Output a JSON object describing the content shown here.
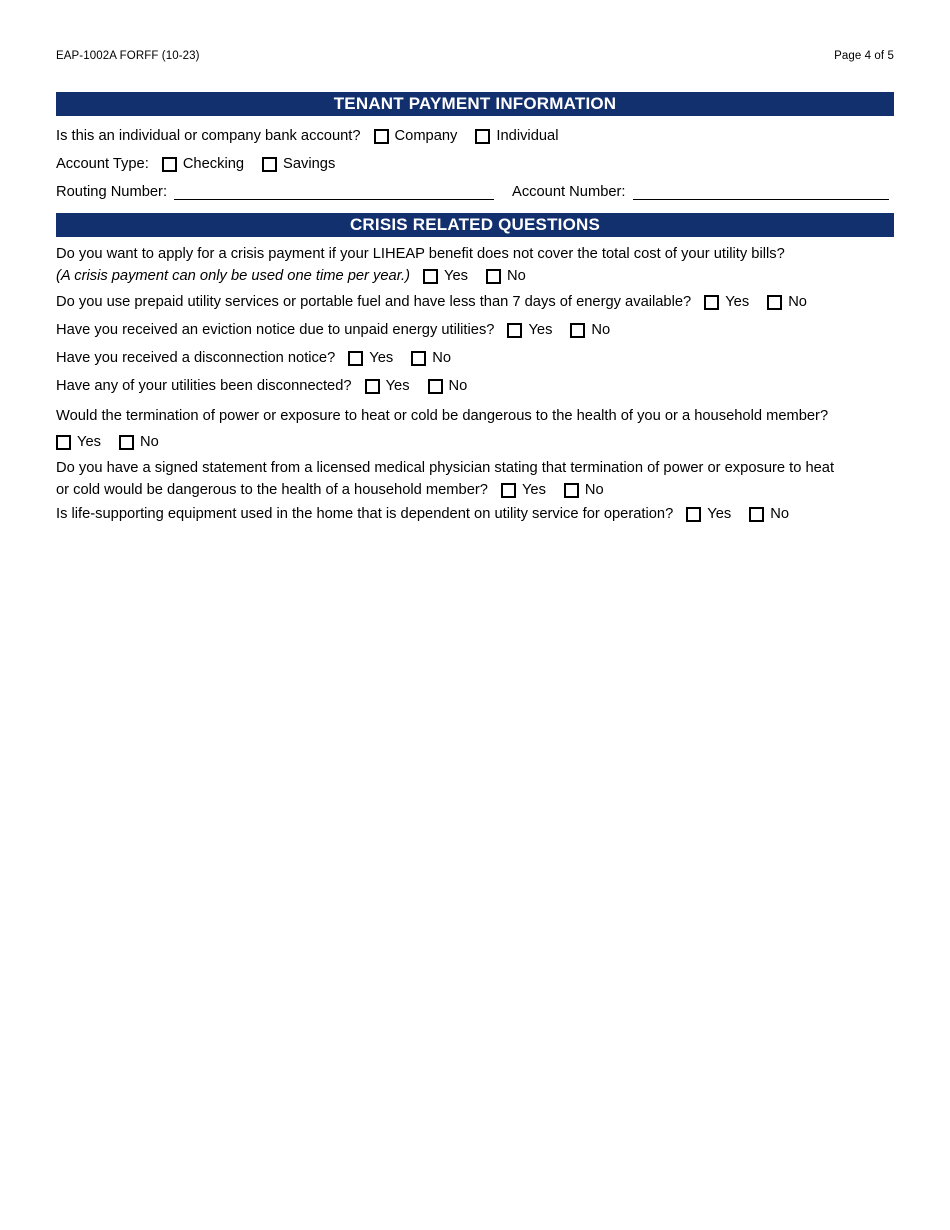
{
  "document": {
    "form_id": "EAP-1002A FORFF (10-23)",
    "page_label": "Page 4 of 5",
    "accent_color": "#13306E"
  },
  "sections": {
    "tenant_payment": {
      "title": "TENANT PAYMENT INFORMATION",
      "account_owner_question": "Is this an individual or company bank account?",
      "account_owner_options": [
        "Company",
        "Individual"
      ],
      "account_type_label": "Account Type:",
      "account_type_options": [
        "Checking",
        "Savings"
      ],
      "routing_label": "Routing Number:",
      "routing_value": "",
      "account_label": "Account Number:",
      "account_value": ""
    },
    "crisis": {
      "title": "CRISIS RELATED QUESTIONS",
      "yes_label": "Yes",
      "no_label": "No",
      "questions": [
        {
          "line1": "Do you want to apply for a crisis payment if your LIHEAP benefit does not cover the total cost of your utility bills?",
          "line2": "(A crisis payment can only be used one time per year.)",
          "line2_italic": true
        },
        {
          "line1": "Do you use prepaid utility services or portable fuel and have less than 7 days of energy available?"
        },
        {
          "line1": "Have you received an eviction notice due to unpaid energy utilities?"
        },
        {
          "line1": "Have you received a disconnection notice?"
        },
        {
          "line1": "Have any of your utilities been disconnected?"
        },
        {
          "line1": "Would the termination of power or exposure to heat or cold be dangerous to the health of you or a household member?"
        },
        {
          "line1": "Do you have a signed statement from a licensed medical physician stating that termination of power or exposure to heat",
          "line2": "or cold would be dangerous to the health of a household member?"
        },
        {
          "line1": "Is life-supporting equipment used in the home that is dependent on utility service for operation?"
        }
      ]
    }
  }
}
